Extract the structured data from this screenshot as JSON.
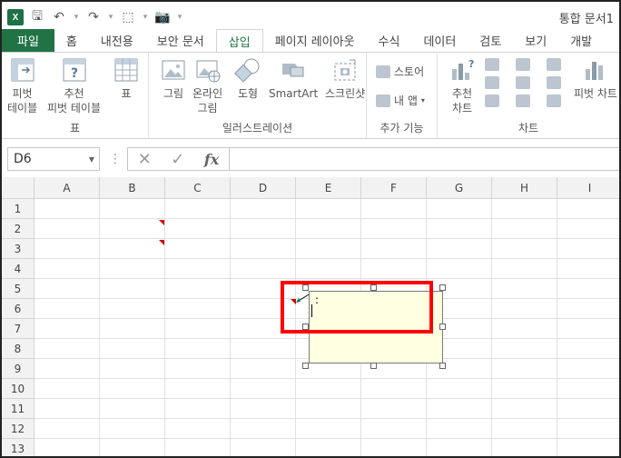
{
  "titlebar": {
    "app_icon": "X",
    "title": "통합 문서1"
  },
  "tabs": [
    {
      "label": "파일"
    },
    {
      "label": "홈"
    },
    {
      "label": "내전용"
    },
    {
      "label": "보안 문서"
    },
    {
      "label": "삽입"
    },
    {
      "label": "페이지 레이아웃"
    },
    {
      "label": "수식"
    },
    {
      "label": "데이터"
    },
    {
      "label": "검토"
    },
    {
      "label": "보기"
    },
    {
      "label": "개발"
    }
  ],
  "ribbon": {
    "groups": {
      "table": {
        "label": "표",
        "pivot": "피벗\n테이블",
        "recommended_pivot": "추천\n피벗 테이블",
        "table": "표"
      },
      "illustrations": {
        "label": "일러스트레이션",
        "picture": "그림",
        "online_picture": "온라인\n그림",
        "shapes": "도형",
        "smartart": "SmartArt",
        "screenshot": "스크린샷"
      },
      "addins": {
        "label": "추가 기능",
        "store": "스토어",
        "my_apps": "내 앱"
      },
      "charts": {
        "label": "차트",
        "recommended": "추천\n차트",
        "pivot_chart": "피벗 차트"
      }
    }
  },
  "formula_bar": {
    "name_box": "D6",
    "fx": "fx",
    "value": ""
  },
  "columns": [
    "A",
    "B",
    "C",
    "D",
    "E",
    "F",
    "G",
    "H",
    "I"
  ],
  "rows": [
    "1",
    "2",
    "3",
    "4",
    "5",
    "6",
    "7",
    "8",
    "9",
    "10",
    "11",
    "12",
    "13"
  ],
  "comment": {
    "text": ":"
  }
}
